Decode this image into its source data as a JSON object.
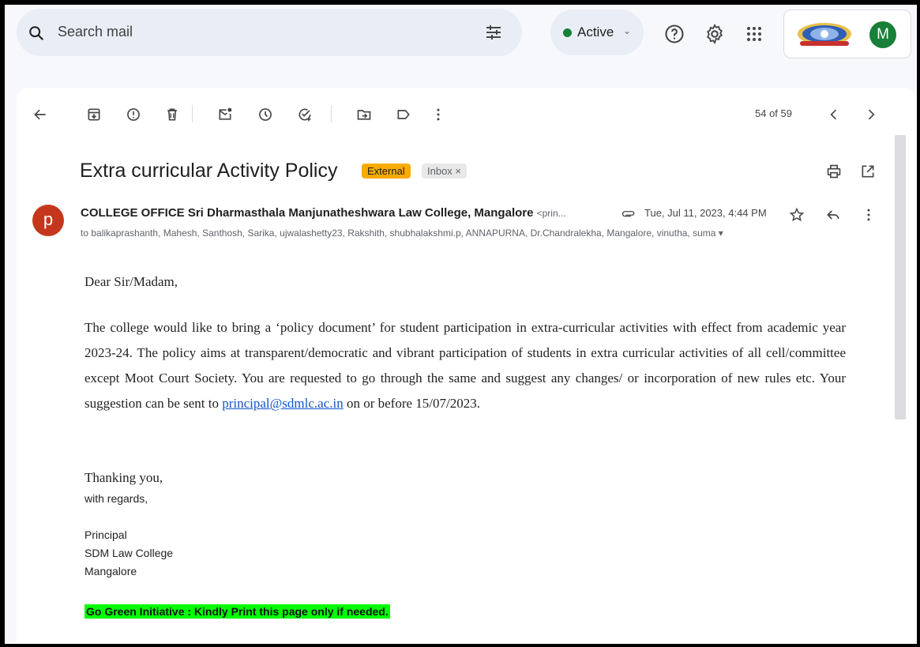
{
  "search": {
    "placeholder": "Search mail"
  },
  "status": {
    "label": "Active"
  },
  "toolbar": {
    "counter": "54 of 59"
  },
  "email": {
    "subject": "Extra curricular Activity Policy",
    "badge_external": "External",
    "badge_inbox": "Inbox ×",
    "sender_initial": "p",
    "sender_name": "COLLEGE OFFICE Sri Dharmasthala Manjunatheshwara Law College, Mangalore",
    "sender_addr": "<prin...",
    "date": "Tue, Jul 11, 2023, 4:44 PM",
    "recipients": "to balikaprashanth, Mahesh, Santhosh, Sarika, ujwalashetty23, Rakshith, shubhalakshmi.p, ANNAPURNA, Dr.Chandralekha, Mangalore, vinutha, suma ▾",
    "greeting": "Dear Sir/Madam,",
    "paragraph_part1": "The college would like to bring a ‘policy document’ for student participation in extra-curricular activities with effect from academic year 2023-24.  The policy aims at transparent/democratic and vibrant participation of students in extra curricular activities of all cell/committee except Moot Court Society.  You are requested to go through the same and suggest any changes/ or incorporation of new rules etc.  Your suggestion can be sent to ",
    "paragraph_link": "principal@sdmlc.ac.in",
    "paragraph_part2": " on or before 15/07/2023.",
    "thanks": "Thanking you,",
    "regards": "with regards,",
    "sig_1": "Principal",
    "sig_2": "SDM Law College",
    "sig_3": "Mangalore",
    "footer": "Go Green Initiative : Kindly Print this page only if needed."
  },
  "account": {
    "initial": "M"
  },
  "colors": {
    "external_badge": "#f9ab00",
    "sender_avatar": "#c5371c",
    "account_avatar": "#188038",
    "green_note": "#00ff00",
    "link": "#1155cc"
  }
}
